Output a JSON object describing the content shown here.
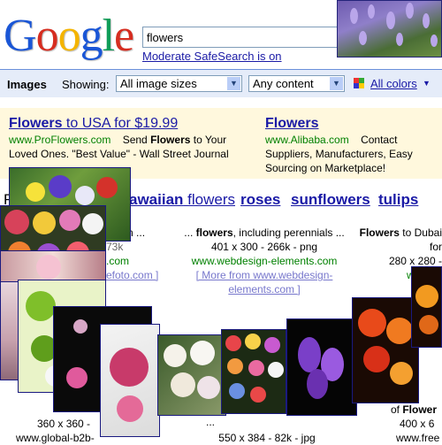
{
  "logo_letters": [
    {
      "char": "G",
      "color": "#1a56d6"
    },
    {
      "char": "o",
      "color": "#d62d20"
    },
    {
      "char": "o",
      "color": "#f4b400"
    },
    {
      "char": "g",
      "color": "#1a56d6"
    },
    {
      "char": "l",
      "color": "#0f9d58"
    },
    {
      "char": "e",
      "color": "#d62d20"
    }
  ],
  "search": {
    "value": "flowers",
    "safesearch": "Moderate SafeSearch is on"
  },
  "toolbar": {
    "section": "Images",
    "showing": "Showing:",
    "sizes": "All image sizes",
    "content": "Any content",
    "colors": "All colors"
  },
  "ads": [
    {
      "title_link": "Flowers",
      "title_rest": " to USA for $19.99",
      "url": "www.ProFlowers.com",
      "text_before": "Send ",
      "text_bold": "Flowers",
      "text_after": " to Your Loved Ones. \"Best Value\" - Wall Street Journal"
    },
    {
      "title_link": "Flowers",
      "title_rest": "",
      "url": "www.Alibaba.com",
      "text_before": "Contact Suppliers, Manufacturers, Easy Sourcing on Marketplace!",
      "text_bold": "",
      "text_after": ""
    }
  ],
  "related": {
    "prefix": "R",
    "hawaiian_link": "awaiian",
    "hawaiian_rest": " flowers",
    "roses": "roses",
    "sunflowers": "sunflowers",
    "tulips": "tulips"
  },
  "results": [
    {
      "desc": "arden ...",
      "size": "",
      "url": ".com",
      "more": "efoto.com ]"
    },
    {
      "desc_pre": "... ",
      "desc_bold": "flowers",
      "desc_post": ", including perennials ...",
      "size": "401 x 300 - 266k - png",
      "url": "www.webdesign-elements.com",
      "more": "[ More from www.webdesign-elements.com ]"
    },
    {
      "desc_bold": "Flowers",
      "desc_post": " to Dubai for",
      "size": "280 x 280 -",
      "url": "www.fl"
    }
  ],
  "bottom": {
    "size1": "360 x 360 -",
    "url1": "www.global-b2b-",
    "size2": "550 x 384 - 82k - jpg",
    "desc3_pre": "of ",
    "desc3_bold": "Flower",
    "size3": "400 x 6",
    "url3": "www.free"
  },
  "misc": {
    "ellipsis": "...",
    "size_frag": "73k"
  }
}
